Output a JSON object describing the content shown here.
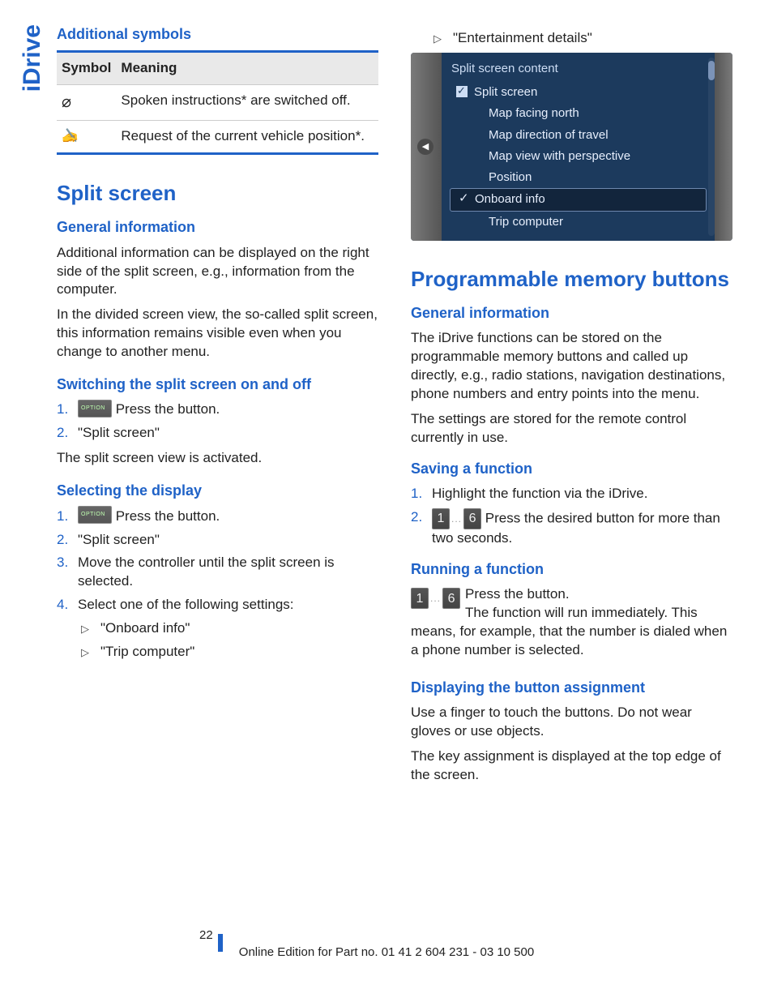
{
  "sidebar_tab": "iDrive",
  "left": {
    "additional_symbols": {
      "heading": "Additional symbols",
      "col1": "Symbol",
      "col2": "Meaning",
      "rows": [
        {
          "meaning": "Spoken instructions* are switched off."
        },
        {
          "meaning": "Request of the current vehicle position*."
        }
      ]
    },
    "split_screen": {
      "heading": "Split screen",
      "general": {
        "heading": "General information",
        "p1": "Additional information can be displayed on the right side of the split screen, e.g., information from the computer.",
        "p2": "In the divided screen view, the so-called split screen, this information remains visible even when you change to another menu."
      },
      "switching": {
        "heading": "Switching the split screen on and off",
        "step1_label": "1.",
        "step1_text": " Press the button.",
        "step2_label": "2.",
        "step2_text": "\"Split screen\"",
        "note": "The split screen view is activated."
      },
      "selecting": {
        "heading": "Selecting the display",
        "step1_label": "1.",
        "step1_text": " Press the button.",
        "step2_label": "2.",
        "step2_text": "\"Split screen\"",
        "step3_label": "3.",
        "step3_text": "Move the controller until the split screen is selected.",
        "step4_label": "4.",
        "step4_text": "Select one of the following settings:",
        "sub": [
          "\"Onboard info\"",
          "\"Trip computer\""
        ]
      }
    }
  },
  "right": {
    "top_bullet": "\"Entertainment details\"",
    "screenshot": {
      "header": "Split screen content",
      "items": [
        {
          "label": "Split screen",
          "type": "checkbox_on"
        },
        {
          "label": "Map facing north",
          "type": "plain"
        },
        {
          "label": "Map direction of travel",
          "type": "plain"
        },
        {
          "label": "Map view with perspective",
          "type": "plain"
        },
        {
          "label": "Position",
          "type": "plain"
        },
        {
          "label": "Onboard info",
          "type": "selected"
        },
        {
          "label": "Trip computer",
          "type": "plain"
        }
      ]
    },
    "prog": {
      "heading": "Programmable memory buttons",
      "general": {
        "heading": "General information",
        "p1": "The iDrive functions can be stored on the programmable memory buttons and called up directly, e.g., radio stations, navigation destinations, phone numbers and entry points into the menu.",
        "p2": "The settings are stored for the remote control currently in use."
      },
      "saving": {
        "heading": "Saving a function",
        "step1_label": "1.",
        "step1_text": "Highlight the function via the iDrive.",
        "step2_label": "2.",
        "step2_text": " Press the desired button for more than two seconds."
      },
      "running": {
        "heading": "Running a function",
        "p1a": " Press the button.",
        "p1b": "The function will run immediately. This means, for example, that the number is dialed when a phone number is selected."
      },
      "display": {
        "heading": "Displaying the button assignment",
        "p1": "Use a finger to touch the buttons. Do not wear gloves or use objects.",
        "p2": "The key assignment is displayed at the top edge of the screen."
      }
    }
  },
  "footer": {
    "page": "22",
    "text": "Online Edition for Part no. 01 41 2 604 231 - 03 10 500"
  }
}
